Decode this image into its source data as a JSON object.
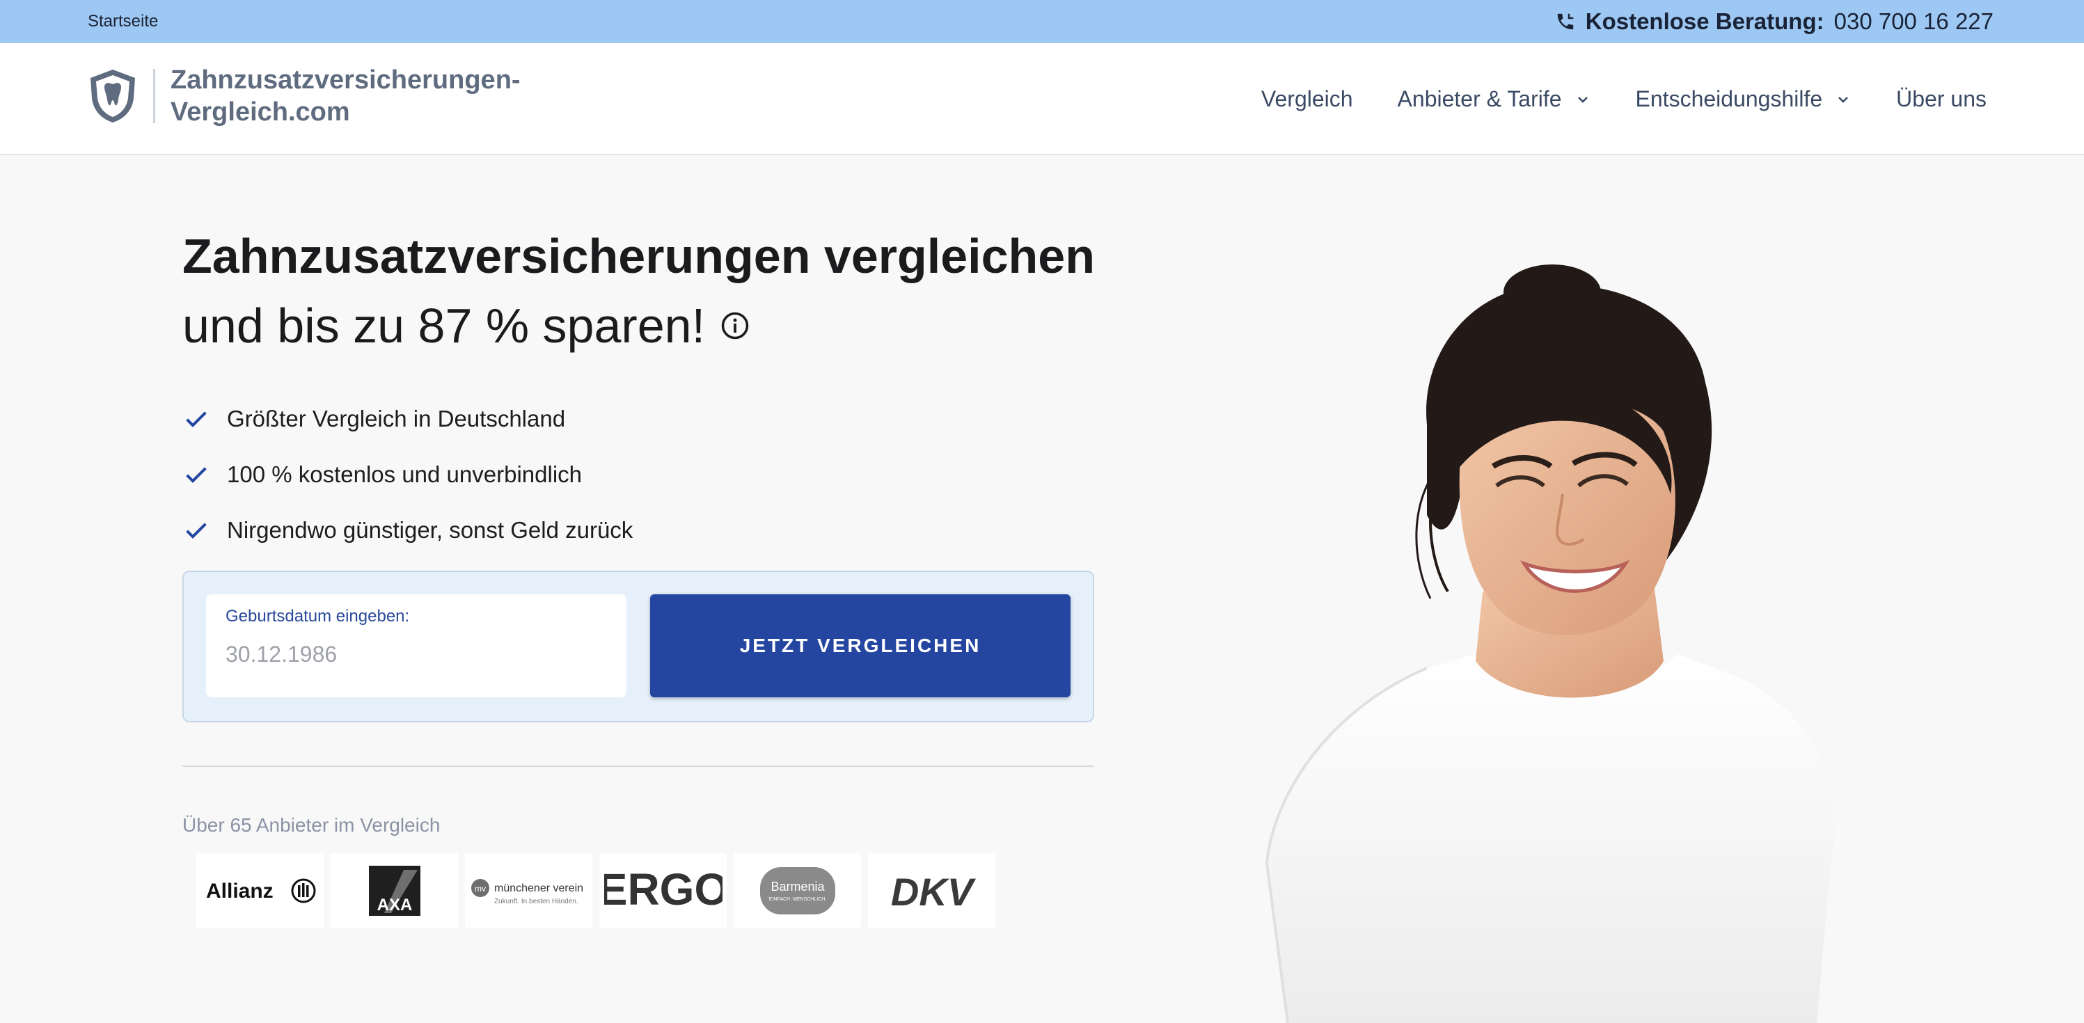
{
  "topbar": {
    "breadcrumb": "Startseite",
    "phone_label": "Kostenlose Beratung:",
    "phone_number": "030 700 16 227",
    "phone_icon": "phone-icon"
  },
  "header": {
    "logo_line1": "Zahnzusatzversicherungen-",
    "logo_line2": "Vergleich.com",
    "nav": [
      {
        "label": "Vergleich"
      },
      {
        "label": "Anbieter & Tarife"
      },
      {
        "label": "Entscheidungshilfe"
      },
      {
        "label": "Über uns"
      }
    ]
  },
  "hero": {
    "title": "Zahnzusatzversicherungen vergleichen",
    "subtitle": "und bis zu 87 % sparen!",
    "benefits": [
      "Größter Vergleich in Deutschland",
      "100 % kostenlos und unverbindlich",
      "Nirgendwo günstiger, sonst Geld zurück"
    ]
  },
  "form": {
    "date_label": "Geburtsdatum eingeben:",
    "date_placeholder": "30.12.1986",
    "cta_label": "JETZT VERGLEICHEN"
  },
  "providers": {
    "label": "Über 65 Anbieter im Vergleich",
    "logos": [
      "Allianz",
      "AXA",
      "münchener verein",
      "ERGO",
      "Barmenia",
      "DKV"
    ],
    "munich_tagline": "Zukunft. In besten Händen.",
    "barmenia_tagline": "EINFACH. MENSCHLICH."
  },
  "colors": {
    "topbar": "#9dc8f3",
    "brand_blue": "#2546a0",
    "form_bg": "#e5f0fb",
    "check": "#2546a0"
  }
}
